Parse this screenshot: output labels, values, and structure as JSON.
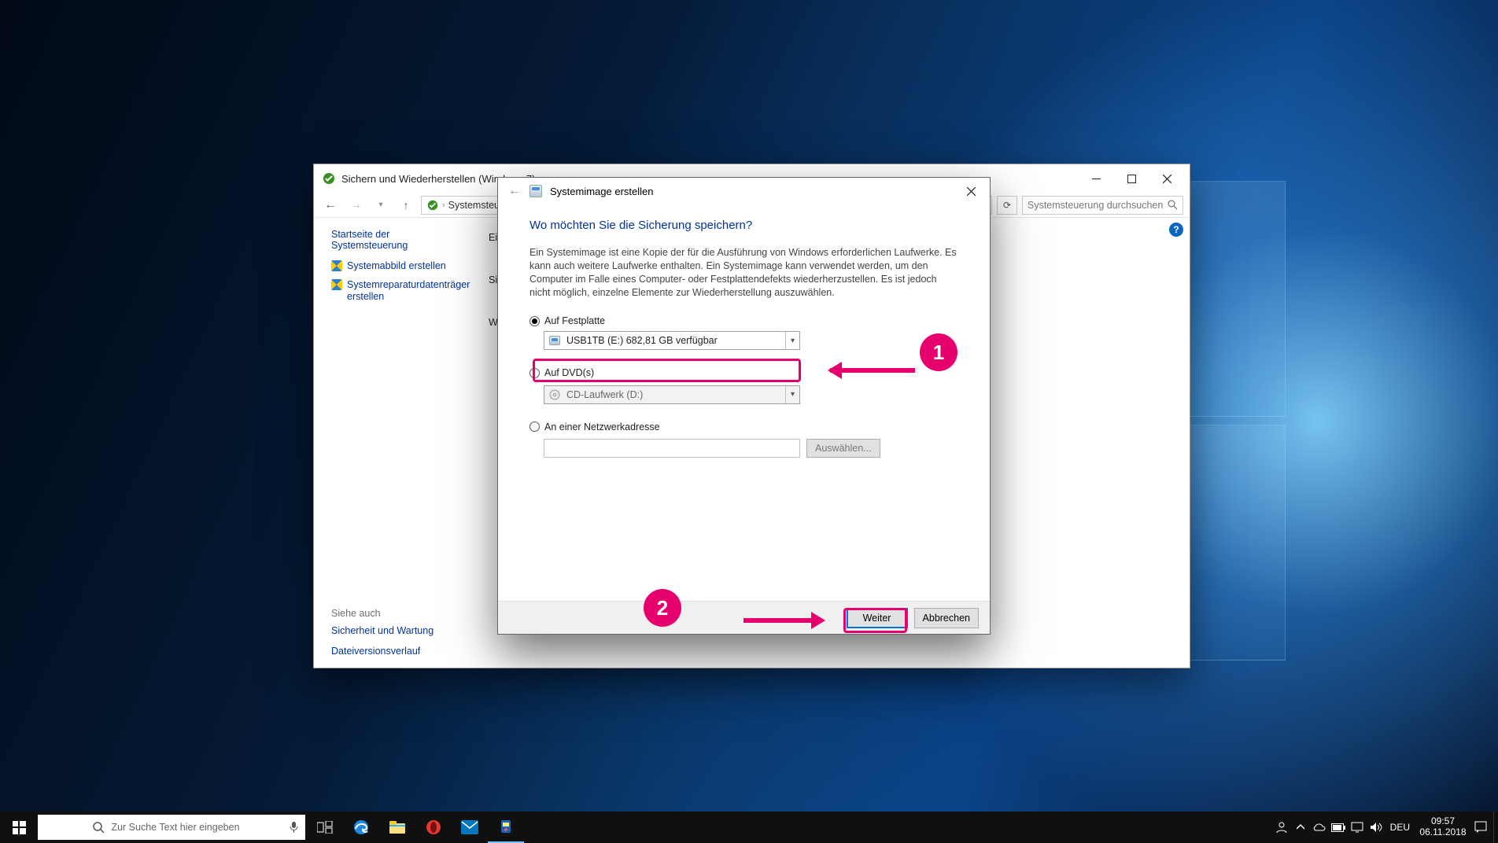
{
  "parent_window": {
    "title": "Sichern und Wiederherstellen (Windows 7)",
    "breadcrumb_root": "Systemsteuerung",
    "search_placeholder": "Systemsteuerung durchsuchen",
    "sidebar": {
      "home": "Startseite der Systemsteuerung",
      "links": [
        "Systemabbild erstellen",
        "Systemreparaturdatenträger erstellen"
      ],
      "see_also_header": "Siehe auch",
      "see_also": [
        "Sicherheit und Wartung",
        "Dateiversionsverlauf"
      ]
    },
    "main_partial": {
      "col1": "Ei",
      "col2": "Si",
      "col3": "Wi"
    }
  },
  "wizard": {
    "title": "Systemimage erstellen",
    "heading": "Wo möchten Sie die Sicherung speichern?",
    "description": "Ein Systemimage ist eine Kopie der für die Ausführung von Windows erforderlichen Laufwerke. Es kann auch weitere Laufwerke enthalten. Ein Systemimage kann verwendet werden, um den Computer im Falle eines Computer- oder Festplattendefekts wiederherzustellen. Es ist jedoch nicht möglich, einzelne Elemente zur Wiederherstellung auszuwählen.",
    "option_disk": {
      "label": "Auf Festplatte",
      "selected_value": "USB1TB (E:)  682,81 GB verfügbar",
      "checked": true
    },
    "option_dvd": {
      "label": "Auf DVD(s)",
      "selected_value": "CD-Laufwerk (D:)",
      "checked": false
    },
    "option_network": {
      "label": "An einer Netzwerkadresse",
      "browse_label": "Auswählen...",
      "checked": false
    },
    "next_button": "Weiter",
    "cancel_button": "Abbrechen"
  },
  "annotations": {
    "one": "1",
    "two": "2",
    "color": "#e6006e"
  },
  "taskbar": {
    "search_placeholder": "Zur Suche Text hier eingeben",
    "language": "DEU",
    "time": "09:57",
    "date": "06.11.2018"
  }
}
